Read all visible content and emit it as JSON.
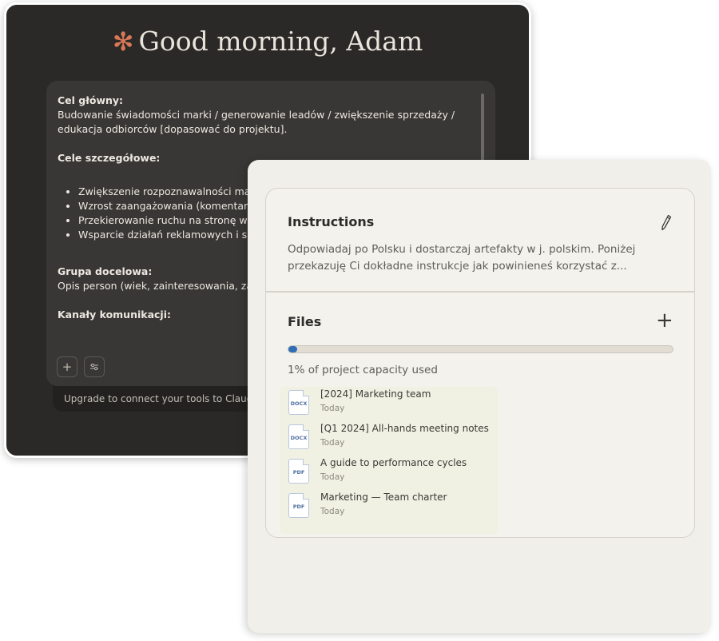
{
  "dark_window": {
    "greeting": "Good morning, Adam",
    "composer": {
      "line1_label": "Cel główny:",
      "line2": "Budowanie świadomości marki / generowanie leadów / zwiększenie sprzedaży /",
      "line3": "edukacja odbiorców [dopasować do projektu].",
      "detail_label": "Cele szczegółowe:",
      "bullets": [
        "Zwiększenie rozpoznawalności ma",
        "Wzrost zaangażowania (komentarz",
        "Przekierowanie ruchu na stronę w",
        "Wsparcie działań reklamowych i sp"
      ],
      "group_label": "Grupa docelowa:",
      "group_text": "Opis person (wiek, zainteresowania, za",
      "channels_label": "Kanały komunikacji:"
    },
    "upgrade_text": "Upgrade to connect your tools to Claude"
  },
  "project_panel": {
    "instructions_title": "Instructions",
    "instructions_line1": "Odpowiadaj po Polsku i dostarczaj artefakty w j. polskim. Poniżej",
    "instructions_line2": "przekazuję Ci dokładne instrukcje jak powinieneś korzystać z...",
    "files_title": "Files",
    "capacity_fraction": 0.01,
    "capacity_text": "1% of project capacity used",
    "files": [
      {
        "type": "DOCX",
        "name": "[2024] Marketing team",
        "date": "Today"
      },
      {
        "type": "DOCX",
        "name": "[Q1 2024] All-hands meeting notes",
        "date": "Today"
      },
      {
        "type": "PDF",
        "name": "A guide to performance cycles",
        "date": "Today"
      },
      {
        "type": "PDF",
        "name": "Marketing — Team charter",
        "date": "Today"
      }
    ]
  },
  "colors": {
    "accent": "#d97757",
    "dark_bg": "#2b2927",
    "composer_bg": "#393735",
    "panel_bg": "#f0efe9",
    "progress_fill": "#2f6db5"
  }
}
